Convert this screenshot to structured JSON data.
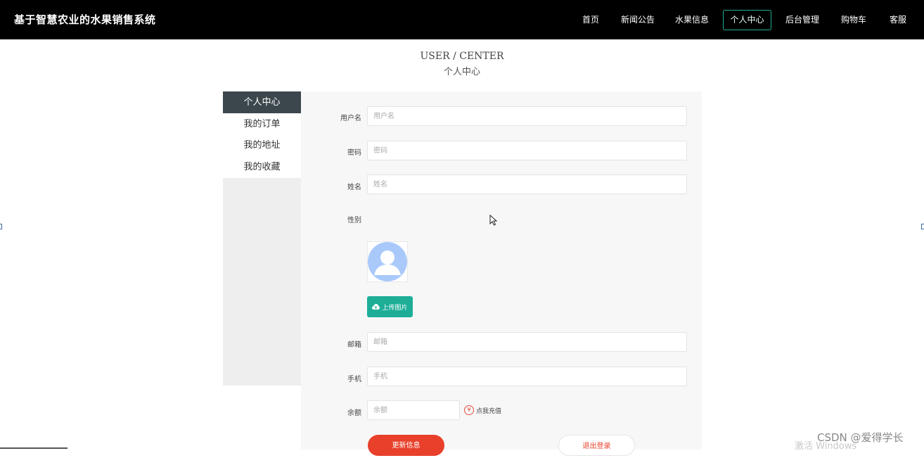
{
  "brand": "基于智慧农业的水果销售系统",
  "nav": [
    {
      "label": "首页",
      "active": false
    },
    {
      "label": "新闻公告",
      "active": false
    },
    {
      "label": "水果信息",
      "active": false
    },
    {
      "label": "个人中心",
      "active": true
    },
    {
      "label": "后台管理",
      "active": false
    },
    {
      "label": "购物车",
      "active": false
    },
    {
      "label": "客服",
      "active": false
    }
  ],
  "section": {
    "title_en": "USER / CENTER",
    "title_cn": "个人中心"
  },
  "sidebar": {
    "items": [
      {
        "label": "个人中心",
        "active": true
      },
      {
        "label": "我的订单",
        "active": false
      },
      {
        "label": "我的地址",
        "active": false
      },
      {
        "label": "我的收藏",
        "active": false
      }
    ]
  },
  "form": {
    "username": {
      "label": "用户名",
      "placeholder": "用户名"
    },
    "password": {
      "label": "密码",
      "placeholder": "密码"
    },
    "name": {
      "label": "姓名",
      "placeholder": "姓名"
    },
    "gender": {
      "label": "性别"
    },
    "upload_label": "上传图片",
    "email": {
      "label": "邮箱",
      "placeholder": "邮箱"
    },
    "phone": {
      "label": "手机",
      "placeholder": "手机"
    },
    "balance": {
      "label": "余额",
      "placeholder": "余额"
    },
    "recharge_symbol": "¥",
    "recharge_label": "点我充值",
    "update_button": "更新信息",
    "logout_button": "退出登录"
  },
  "watermarks": {
    "activate": "激活 Windows",
    "csdn": "CSDN @爱得学长"
  },
  "colors": {
    "topbar": "#000000",
    "active_nav_border": "#1fae9a",
    "sidebar_active": "#3c474d",
    "upload_button": "#1eae98",
    "update_button": "#e8402b"
  }
}
